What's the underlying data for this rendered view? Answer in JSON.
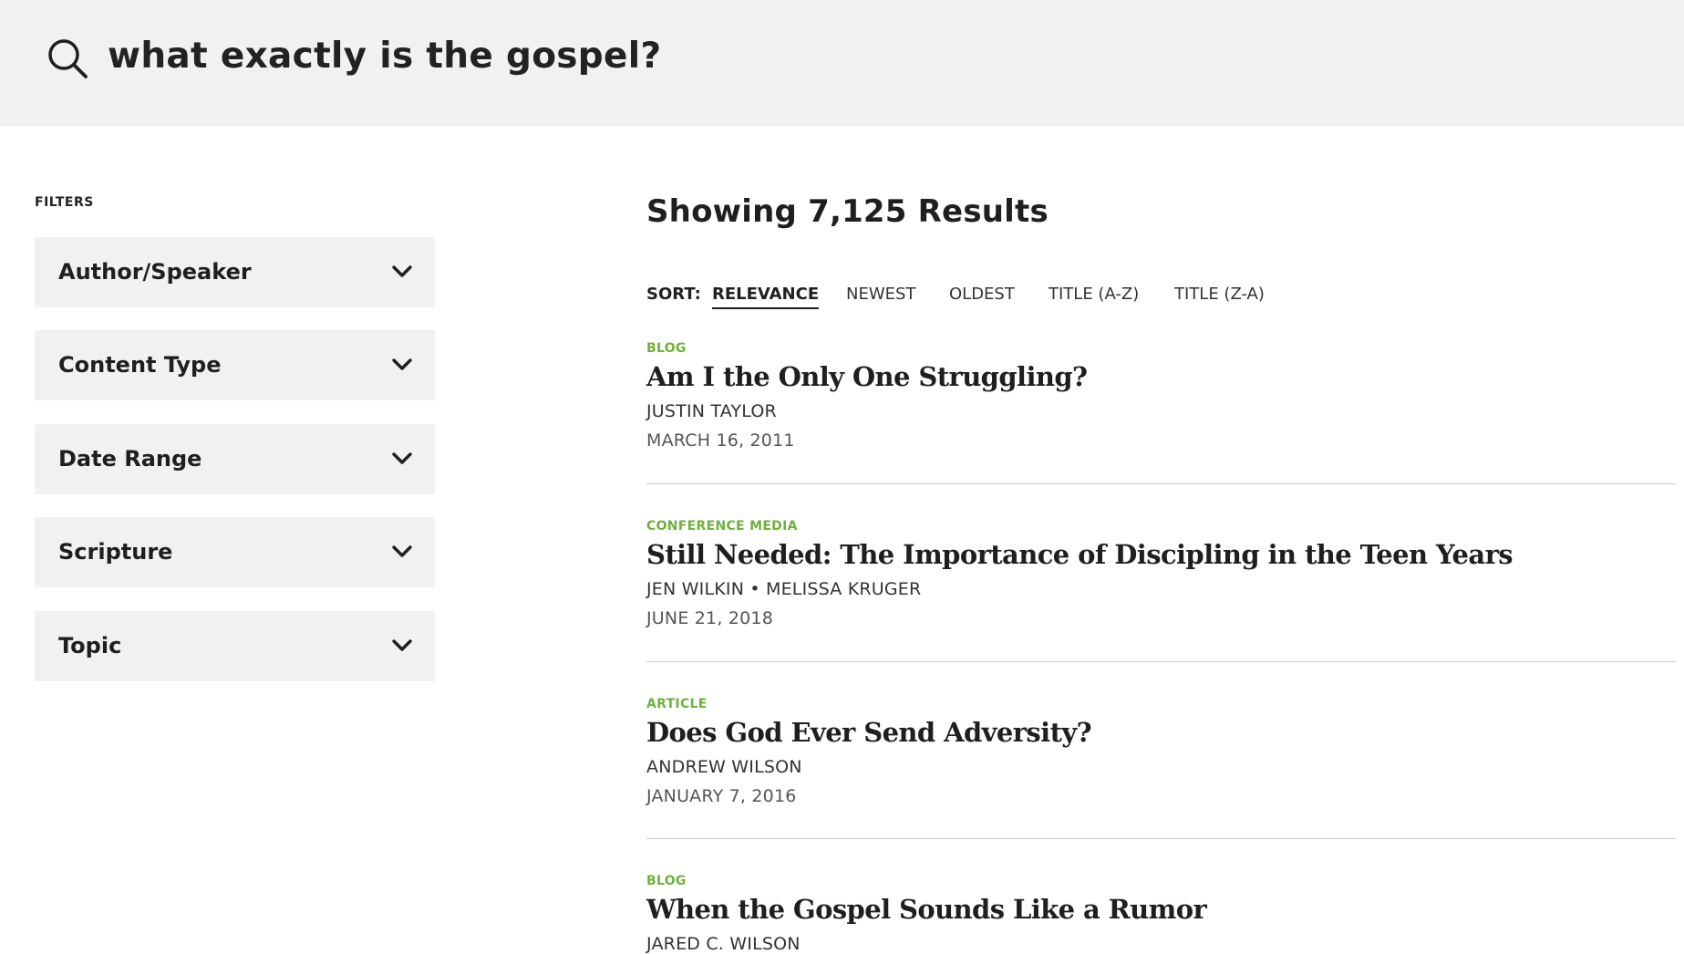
{
  "search": {
    "query": "what exactly is the gospel?"
  },
  "filters": {
    "label": "FILTERS",
    "items": [
      {
        "label": "Author/Speaker"
      },
      {
        "label": "Content Type"
      },
      {
        "label": "Date Range"
      },
      {
        "label": "Scripture"
      },
      {
        "label": "Topic"
      }
    ]
  },
  "results": {
    "heading": "Showing 7,125 Results",
    "sort": {
      "label": "SORT:",
      "options": [
        "RELEVANCE",
        "NEWEST",
        "OLDEST",
        "TITLE (A-Z)",
        "TITLE (Z-A)"
      ],
      "active": "RELEVANCE"
    },
    "items": [
      {
        "type": "BLOG",
        "title": "Am I the Only One Struggling?",
        "author": "JUSTIN TAYLOR",
        "date": "MARCH 16, 2011"
      },
      {
        "type": "CONFERENCE MEDIA",
        "title": "Still Needed: The Importance of Discipling in the Teen Years",
        "author": "JEN WILKIN • MELISSA KRUGER",
        "date": "JUNE 21, 2018"
      },
      {
        "type": "ARTICLE",
        "title": "Does God Ever Send Adversity?",
        "author": "ANDREW WILSON",
        "date": "JANUARY 7, 2016"
      },
      {
        "type": "BLOG",
        "title": "When the Gospel Sounds Like a Rumor",
        "author": "JARED C. WILSON",
        "date": ""
      }
    ]
  },
  "colors": {
    "header_bg": "#f1f1f1",
    "filter_bg": "#f1f1f1",
    "content_type_accent": "#6fb13c",
    "divider": "#c9c9c9"
  },
  "icons": {
    "search": "search-icon",
    "filter_toggle": "chevron-down-icon"
  }
}
